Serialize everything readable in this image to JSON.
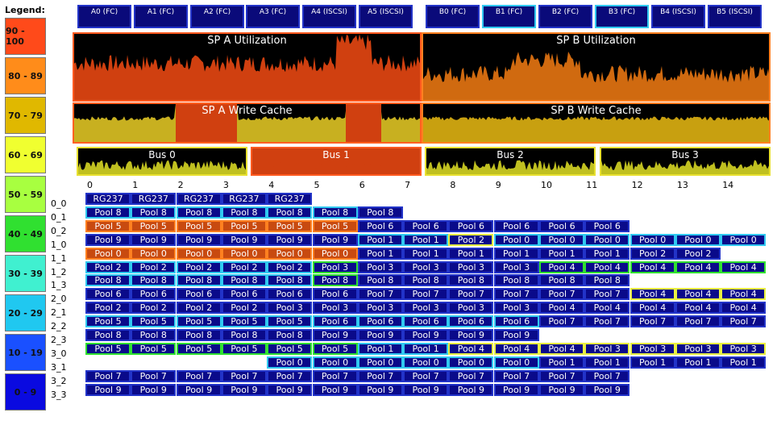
{
  "legend": {
    "title": "Legend:",
    "items": [
      {
        "label": "90 - 100",
        "color": "#ff4a1a"
      },
      {
        "label": "80 - 89",
        "color": "#ff8c1a"
      },
      {
        "label": "70 - 79",
        "color": "#e0b800"
      },
      {
        "label": "60 - 69",
        "color": "#f0ff30"
      },
      {
        "label": "50 - 59",
        "color": "#a8ff40"
      },
      {
        "label": "40 - 49",
        "color": "#30e030"
      },
      {
        "label": "30 - 39",
        "color": "#40f0d0"
      },
      {
        "label": "20 - 29",
        "color": "#20c8f0"
      },
      {
        "label": "10 - 19",
        "color": "#1a50ff"
      },
      {
        "label": "0 - 9",
        "color": "#0a0ae0"
      }
    ]
  },
  "ports": [
    {
      "label": "A0 (FC)",
      "border": "#2233c8"
    },
    {
      "label": "A1 (FC)",
      "border": "#2233c8"
    },
    {
      "label": "A2 (FC)",
      "border": "#2233c8"
    },
    {
      "label": "A3 (FC)",
      "border": "#2233c8"
    },
    {
      "label": "A4 (ISCSI)",
      "border": "#2233c8"
    },
    {
      "label": "A5 (ISCSI)",
      "border": "#2233c8"
    },
    {
      "label": "B0 (FC)",
      "border": "#2233c8"
    },
    {
      "label": "B1 (FC)",
      "border": "#30c8f0"
    },
    {
      "label": "B2 (FC)",
      "border": "#2233c8"
    },
    {
      "label": "B3 (FC)",
      "border": "#30c8f0"
    },
    {
      "label": "B4 (ISCSI)",
      "border": "#2233c8"
    },
    {
      "label": "B5 (ISCSI)",
      "border": "#2233c8"
    }
  ],
  "panels": {
    "sp_a_util": {
      "label": "SP A Utilization",
      "border": "#ff5a20",
      "fill": "#d04010"
    },
    "sp_b_util": {
      "label": "SP B Utilization",
      "border": "#ff8020",
      "fill": "#d06a10"
    },
    "sp_a_cache": {
      "label": "SP A Write Cache",
      "border": "#ff6020",
      "fill": "#c8b020"
    },
    "sp_b_cache": {
      "label": "SP B Write Cache",
      "border": "#ff8020",
      "fill": "#c8a010"
    }
  },
  "buses": [
    {
      "label": "Bus 0",
      "border": "#e8e030",
      "fill": "#c0c020"
    },
    {
      "label": "Bus 1",
      "border": "#ff5a20",
      "fill": "#d04010"
    },
    {
      "label": "Bus 2",
      "border": "#e8e030",
      "fill": "#c0c020"
    },
    {
      "label": "Bus 3",
      "border": "#e8e030",
      "fill": "#c0c020"
    }
  ],
  "columns": [
    "0",
    "1",
    "2",
    "3",
    "4",
    "5",
    "6",
    "7",
    "8",
    "9",
    "10",
    "11",
    "12",
    "13",
    "14"
  ],
  "rows": [
    {
      "label": "0_0",
      "start": 0,
      "cells": [
        [
          "RG237",
          "b"
        ],
        [
          "RG237",
          "b"
        ],
        [
          "RG237",
          "b"
        ],
        [
          "RG237",
          "b"
        ],
        [
          "RG237",
          "b"
        ]
      ]
    },
    {
      "label": "0_1",
      "start": 0,
      "cells": [
        [
          "Pool 8",
          "c"
        ],
        [
          "Pool 8",
          "c"
        ],
        [
          "Pool 8",
          "c"
        ],
        [
          "Pool 8",
          "c"
        ],
        [
          "Pool 8",
          "c"
        ],
        [
          "Pool 8",
          "c"
        ],
        [
          "Pool 8",
          "b"
        ]
      ]
    },
    {
      "label": "0_2",
      "start": 0,
      "cells": [
        [
          "Pool 5",
          "o"
        ],
        [
          "Pool 5",
          "o"
        ],
        [
          "Pool 5",
          "o"
        ],
        [
          "Pool 5",
          "o"
        ],
        [
          "Pool 5",
          "o"
        ],
        [
          "Pool 5",
          "o"
        ],
        [
          "Pool 6",
          "b"
        ],
        [
          "Pool 6",
          "b"
        ],
        [
          "Pool 6",
          "b"
        ],
        [
          "Pool 6",
          "b"
        ],
        [
          "Pool 6",
          "b"
        ],
        [
          "Pool 6",
          "b"
        ]
      ]
    },
    {
      "label": "1_0",
      "start": 0,
      "cells": [
        [
          "Pool 9",
          "b"
        ],
        [
          "Pool 9",
          "b"
        ],
        [
          "Pool 9",
          "b"
        ],
        [
          "Pool 9",
          "b"
        ],
        [
          "Pool 9",
          "b"
        ],
        [
          "Pool 9",
          "b"
        ],
        [
          "Pool 1",
          "c"
        ],
        [
          "Pool 1",
          "c"
        ],
        [
          "Pool 2",
          "y"
        ],
        [
          "Pool 0",
          "c"
        ],
        [
          "Pool 0",
          "c"
        ],
        [
          "Pool 0",
          "c"
        ],
        [
          "Pool 0",
          "c"
        ],
        [
          "Pool 0",
          "c"
        ],
        [
          "Pool 0",
          "c"
        ]
      ]
    },
    {
      "label": "1_1",
      "start": 0,
      "cells": [
        [
          "Pool 0",
          "o"
        ],
        [
          "Pool 0",
          "o"
        ],
        [
          "Pool 0",
          "o"
        ],
        [
          "Pool 0",
          "o"
        ],
        [
          "Pool 0",
          "o"
        ],
        [
          "Pool 0",
          "o"
        ],
        [
          "Pool 1",
          "b"
        ],
        [
          "Pool 1",
          "b"
        ],
        [
          "Pool 1",
          "b"
        ],
        [
          "Pool 1",
          "b"
        ],
        [
          "Pool 1",
          "b"
        ],
        [
          "Pool 1",
          "b"
        ],
        [
          "Pool 2",
          "b"
        ],
        [
          "Pool 2",
          "b"
        ]
      ]
    },
    {
      "label": "1_2",
      "start": 0,
      "cells": [
        [
          "Pool 2",
          "c"
        ],
        [
          "Pool 2",
          "c"
        ],
        [
          "Pool 2",
          "c"
        ],
        [
          "Pool 2",
          "c"
        ],
        [
          "Pool 2",
          "c"
        ],
        [
          "Pool 3",
          "g"
        ],
        [
          "Pool 3",
          "b"
        ],
        [
          "Pool 3",
          "b"
        ],
        [
          "Pool 3",
          "b"
        ],
        [
          "Pool 3",
          "b"
        ],
        [
          "Pool 4",
          "g"
        ],
        [
          "Pool 4",
          "g"
        ],
        [
          "Pool 4",
          "g"
        ],
        [
          "Pool 4",
          "g"
        ],
        [
          "Pool 4",
          "g"
        ]
      ]
    },
    {
      "label": "1_3",
      "start": 0,
      "cells": [
        [
          "Pool 8",
          "c"
        ],
        [
          "Pool 8",
          "c"
        ],
        [
          "Pool 8",
          "c"
        ],
        [
          "Pool 8",
          "c"
        ],
        [
          "Pool 8",
          "c"
        ],
        [
          "Pool 8",
          "g"
        ],
        [
          "Pool 8",
          "b"
        ],
        [
          "Pool 8",
          "b"
        ],
        [
          "Pool 8",
          "b"
        ],
        [
          "Pool 8",
          "b"
        ],
        [
          "Pool 8",
          "b"
        ],
        [
          "Pool 8",
          "b"
        ]
      ]
    },
    {
      "label": "2_0",
      "start": 0,
      "cells": [
        [
          "Pool 6",
          "b"
        ],
        [
          "Pool 6",
          "b"
        ],
        [
          "Pool 6",
          "b"
        ],
        [
          "Pool 6",
          "b"
        ],
        [
          "Pool 6",
          "b"
        ],
        [
          "Pool 6",
          "b"
        ],
        [
          "Pool 7",
          "b"
        ],
        [
          "Pool 7",
          "b"
        ],
        [
          "Pool 7",
          "b"
        ],
        [
          "Pool 7",
          "b"
        ],
        [
          "Pool 7",
          "b"
        ],
        [
          "Pool 7",
          "b"
        ],
        [
          "Pool 4",
          "y"
        ],
        [
          "Pool 4",
          "y"
        ],
        [
          "Pool 4",
          "y"
        ]
      ]
    },
    {
      "label": "2_1",
      "start": 0,
      "cells": [
        [
          "Pool 2",
          "b"
        ],
        [
          "Pool 2",
          "b"
        ],
        [
          "Pool 2",
          "b"
        ],
        [
          "Pool 2",
          "b"
        ],
        [
          "Pool 3",
          "b"
        ],
        [
          "Pool 3",
          "b"
        ],
        [
          "Pool 3",
          "b"
        ],
        [
          "Pool 3",
          "b"
        ],
        [
          "Pool 3",
          "b"
        ],
        [
          "Pool 3",
          "b"
        ],
        [
          "Pool 4",
          "b"
        ],
        [
          "Pool 4",
          "b"
        ],
        [
          "Pool 4",
          "b"
        ],
        [
          "Pool 4",
          "b"
        ],
        [
          "Pool 4",
          "b"
        ]
      ]
    },
    {
      "label": "2_2",
      "start": 0,
      "cells": [
        [
          "Pool 5",
          "c"
        ],
        [
          "Pool 5",
          "c"
        ],
        [
          "Pool 5",
          "c"
        ],
        [
          "Pool 5",
          "c"
        ],
        [
          "Pool 5",
          "c"
        ],
        [
          "Pool 6",
          "c"
        ],
        [
          "Pool 6",
          "c"
        ],
        [
          "Pool 6",
          "c"
        ],
        [
          "Pool 6",
          "c"
        ],
        [
          "Pool 6",
          "c"
        ],
        [
          "Pool 7",
          "b"
        ],
        [
          "Pool 7",
          "b"
        ],
        [
          "Pool 7",
          "b"
        ],
        [
          "Pool 7",
          "b"
        ],
        [
          "Pool 7",
          "b"
        ]
      ]
    },
    {
      "label": "2_3",
      "start": 0,
      "cells": [
        [
          "Pool 8",
          "b"
        ],
        [
          "Pool 8",
          "b"
        ],
        [
          "Pool 8",
          "b"
        ],
        [
          "Pool 8",
          "b"
        ],
        [
          "Pool 8",
          "b"
        ],
        [
          "Pool 9",
          "b"
        ],
        [
          "Pool 9",
          "b"
        ],
        [
          "Pool 9",
          "b"
        ],
        [
          "Pool 9",
          "b"
        ],
        [
          "Pool 9",
          "b"
        ]
      ]
    },
    {
      "label": "3_0",
      "start": 0,
      "cells": [
        [
          "Pool 5",
          "g"
        ],
        [
          "Pool 5",
          "g"
        ],
        [
          "Pool 5",
          "g"
        ],
        [
          "Pool 5",
          "g"
        ],
        [
          "Pool 5",
          "g"
        ],
        [
          "Pool 5",
          "g"
        ],
        [
          "Pool 1",
          "c"
        ],
        [
          "Pool 1",
          "c"
        ],
        [
          "Pool 4",
          "y"
        ],
        [
          "Pool 4",
          "y"
        ],
        [
          "Pool 4",
          "y"
        ],
        [
          "Pool 3",
          "y"
        ],
        [
          "Pool 3",
          "y"
        ],
        [
          "Pool 3",
          "y"
        ],
        [
          "Pool 3",
          "y"
        ]
      ]
    },
    {
      "label": "3_1",
      "start": 4,
      "cells": [
        [
          "Pool 0",
          "c"
        ],
        [
          "Pool 0",
          "c"
        ],
        [
          "Pool 0",
          "c"
        ],
        [
          "Pool 0",
          "c"
        ],
        [
          "Pool 0",
          "c"
        ],
        [
          "Pool 0",
          "c"
        ],
        [
          "Pool 1",
          "b"
        ],
        [
          "Pool 1",
          "b"
        ],
        [
          "Pool 1",
          "b"
        ],
        [
          "Pool 1",
          "b"
        ],
        [
          "Pool 1",
          "b"
        ]
      ]
    },
    {
      "label": "3_2",
      "start": 0,
      "cells": [
        [
          "Pool 7",
          "b"
        ],
        [
          "Pool 7",
          "b"
        ],
        [
          "Pool 7",
          "b"
        ],
        [
          "Pool 7",
          "b"
        ],
        [
          "Pool 7",
          "b"
        ],
        [
          "Pool 7",
          "b"
        ],
        [
          "Pool 7",
          "b"
        ],
        [
          "Pool 7",
          "b"
        ],
        [
          "Pool 7",
          "b"
        ],
        [
          "Pool 7",
          "b"
        ],
        [
          "Pool 7",
          "b"
        ],
        [
          "Pool 7",
          "b"
        ]
      ]
    },
    {
      "label": "3_3",
      "start": 0,
      "cells": [
        [
          "Pool 9",
          "b"
        ],
        [
          "Pool 9",
          "b"
        ],
        [
          "Pool 9",
          "b"
        ],
        [
          "Pool 9",
          "b"
        ],
        [
          "Pool 9",
          "b"
        ],
        [
          "Pool 9",
          "b"
        ],
        [
          "Pool 9",
          "b"
        ],
        [
          "Pool 9",
          "b"
        ],
        [
          "Pool 9",
          "b"
        ],
        [
          "Pool 9",
          "b"
        ],
        [
          "Pool 9",
          "b"
        ],
        [
          "Pool 9",
          "b"
        ]
      ]
    }
  ],
  "cell_styles": {
    "b": {
      "bg": "#0a0a8a",
      "border": "#2233c8"
    },
    "c": {
      "bg": "#0a0a8a",
      "border": "#30c8f0"
    },
    "o": {
      "bg": "#c84a10",
      "border": "#ff8020"
    },
    "y": {
      "bg": "#0a0a8a",
      "border": "#e8f040"
    },
    "g": {
      "bg": "#0a0a8a",
      "border": "#30e030"
    }
  }
}
